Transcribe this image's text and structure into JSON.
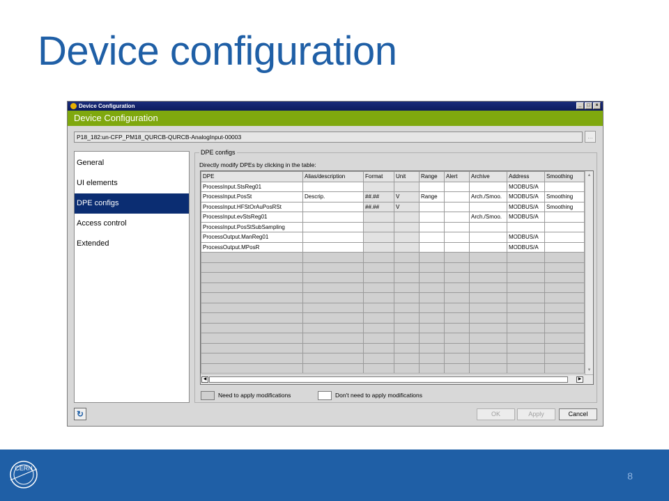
{
  "slide": {
    "title": "Device configuration",
    "page_number": "8",
    "logo_text": "CERN",
    "colors": {
      "title": "#1f5fa6",
      "footer": "#1f5fa6",
      "header_band": "#7fa80e",
      "nav_selected": "#0b2d72"
    }
  },
  "window": {
    "title": "Device Configuration",
    "header": "Device Configuration",
    "device_path": "P18_182:un-CFP_PM18_QURCB-QURCB-AnalogInput-00003",
    "controls": [
      "minimize-icon",
      "maximize-icon",
      "close-icon"
    ]
  },
  "nav": {
    "items": [
      {
        "label": "General",
        "selected": false
      },
      {
        "label": "UI elements",
        "selected": false
      },
      {
        "label": "DPE configs",
        "selected": true
      },
      {
        "label": "Access control",
        "selected": false
      },
      {
        "label": "Extended",
        "selected": false
      }
    ]
  },
  "dpe": {
    "group_label": "DPE configs",
    "hint": "Directly modify DPEs by clicking in the table:",
    "columns": [
      "DPE",
      "Alias/description",
      "Format",
      "Unit",
      "Range",
      "Alert",
      "Archive",
      "Address",
      "Smoothing"
    ],
    "rows": [
      [
        "ProcessInput.StsReg01",
        "",
        "",
        "",
        "",
        "",
        "",
        "MODBUS/A",
        ""
      ],
      [
        "ProcessInput.PosSt",
        "Descrip.",
        "##.##",
        "V",
        "Range",
        "",
        "Arch./Smoo.",
        "MODBUS/A",
        "Smoothing"
      ],
      [
        "ProcessInput.HFStOrAuPosRSt",
        "",
        "##.##",
        "V",
        "",
        "",
        "",
        "MODBUS/A",
        "Smoothing"
      ],
      [
        "ProcessInput.evStsReg01",
        "",
        "",
        "",
        "",
        "",
        "Arch./Smoo.",
        "MODBUS/A",
        ""
      ],
      [
        "ProcessInput.PosStSubSampling",
        "",
        "",
        "",
        "",
        "",
        "",
        "",
        ""
      ],
      [
        "ProcessOutput.ManReg01",
        "",
        "",
        "",
        "",
        "",
        "",
        "MODBUS/A",
        ""
      ],
      [
        "ProcessOutput.MPosR",
        "",
        "",
        "",
        "",
        "",
        "",
        "MODBUS/A",
        ""
      ]
    ],
    "empty_row_count": 12
  },
  "legend": {
    "modified": "Need to apply modifications",
    "unmodified": "Don't need to apply modifications",
    "modified_color": "#d0d0d0",
    "unmodified_color": "#ffffff"
  },
  "buttons": {
    "ok": "OK",
    "apply": "Apply",
    "cancel": "Cancel",
    "refresh_icon": "refresh-icon"
  }
}
